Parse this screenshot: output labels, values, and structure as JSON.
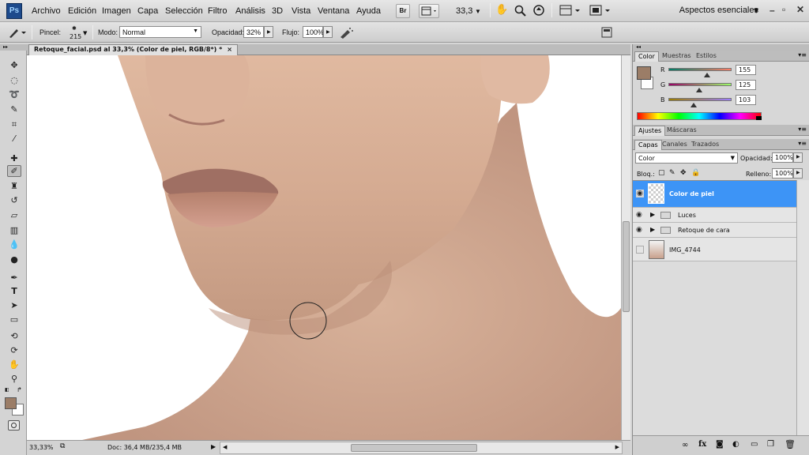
{
  "app": {
    "logo": "Ps"
  },
  "menu": [
    "Archivo",
    "Edición",
    "Imagen",
    "Capa",
    "Selección",
    "Filtro",
    "Análisis",
    "3D",
    "Vista",
    "Ventana",
    "Ayuda"
  ],
  "appbar": {
    "bridge_label": "Br",
    "zoom": "33,3",
    "workspace": "Aspectos esenciales"
  },
  "options": {
    "brush_label": "Pincel:",
    "brush_size": "215",
    "mode_label": "Modo:",
    "mode_value": "Normal",
    "opacity_label": "Opacidad:",
    "opacity_value": "32%",
    "flow_label": "Flujo:",
    "flow_value": "100%"
  },
  "document": {
    "tab_title": "Retoque_facial.psd al 33,3% (Color de piel, RGB/8*) *",
    "status_zoom": "33,33%",
    "status_doc": "Doc: 36,4 MB/235,4 MB"
  },
  "color_panel": {
    "tabs": [
      "Color",
      "Muestras",
      "Estilos"
    ],
    "r_label": "R",
    "g_label": "G",
    "b_label": "B",
    "r": "155",
    "g": "125",
    "b": "103",
    "r_level": 0.61,
    "g_level": 0.49,
    "b_level": 0.4,
    "foreground": "#9b7d67"
  },
  "adjust_panel": {
    "tabs": [
      "Ajustes",
      "Máscaras"
    ]
  },
  "layers_panel": {
    "tabs": [
      "Capas",
      "Canales",
      "Trazados"
    ],
    "blend_mode": "Color",
    "opacity_label": "Opacidad:",
    "opacity_value": "100%",
    "lock_label": "Bloq.:",
    "fill_label": "Relleno:",
    "fill_value": "100%",
    "layers": [
      {
        "name": "Color de piel",
        "selected": true
      },
      {
        "name": "Luces"
      },
      {
        "name": "Retoque de cara"
      },
      {
        "name": "IMG_4744"
      }
    ]
  }
}
